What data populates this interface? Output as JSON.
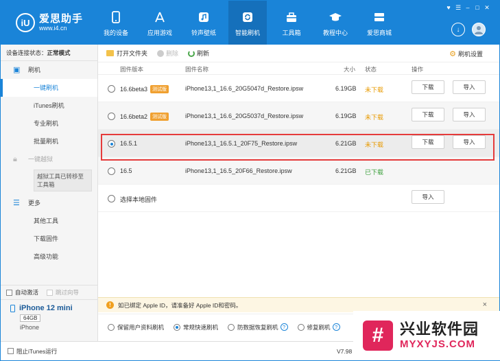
{
  "header": {
    "logo_mark": "iU",
    "logo_name": "爱思助手",
    "logo_url": "www.i4.cn",
    "nav": [
      {
        "label": "我的设备",
        "icon": "phone-icon"
      },
      {
        "label": "应用游戏",
        "icon": "app-store-icon"
      },
      {
        "label": "铃声壁纸",
        "icon": "music-icon"
      },
      {
        "label": "智能刷机",
        "icon": "flash-icon"
      },
      {
        "label": "工具箱",
        "icon": "toolbox-icon"
      },
      {
        "label": "教程中心",
        "icon": "graduation-cap-icon"
      },
      {
        "label": "爱思商城",
        "icon": "store-icon"
      }
    ],
    "active_nav": 3
  },
  "sidebar": {
    "status_label": "设备连接状态：",
    "status_value": "正常模式",
    "group_flash": "刷机",
    "items_flash": [
      "一键刷机",
      "iTunes刷机",
      "专业刷机",
      "批量刷机"
    ],
    "group_jailbreak": "一键越狱",
    "jailbreak_note": "越狱工具已转移至工具箱",
    "group_more": "更多",
    "items_more": [
      "其他工具",
      "下载固件",
      "高级功能"
    ],
    "check_auto_activate": "自动激活",
    "check_skip_guide": "跳过向导",
    "device_name": "iPhone 12 mini",
    "device_capacity": "64GB",
    "device_model": "iPhone"
  },
  "toolbar": {
    "open_folder": "打开文件夹",
    "delete": "删除",
    "refresh": "刷新",
    "flash_settings": "刷机设置"
  },
  "table": {
    "headers": {
      "version": "固件版本",
      "name": "固件名称",
      "size": "大小",
      "status": "状态",
      "action": "操作"
    },
    "rows": [
      {
        "version": "16.6beta3",
        "badge": "测试版",
        "name": "iPhone13,1_16.6_20G5047d_Restore.ipsw",
        "size": "6.19GB",
        "status": "未下载",
        "btn_download": "下载",
        "btn_import": "导入"
      },
      {
        "version": "16.6beta2",
        "badge": "测试版",
        "name": "iPhone13,1_16.6_20G5037d_Restore.ipsw",
        "size": "6.19GB",
        "status": "未下载",
        "btn_download": "下载",
        "btn_import": "导入"
      },
      {
        "version": "16.5.1",
        "badge": "",
        "name": "iPhone13,1_16.5.1_20F75_Restore.ipsw",
        "size": "6.21GB",
        "status": "未下载",
        "btn_download": "下载",
        "btn_import": "导入"
      },
      {
        "version": "16.5",
        "badge": "",
        "name": "iPhone13,1_16.5_20F66_Restore.ipsw",
        "size": "6.21GB",
        "status": "已下载"
      }
    ],
    "local_firmware": "选择本地固件",
    "local_import": "导入"
  },
  "notice": {
    "text": "如已绑定 Apple ID，请准备好 Apple ID和密码。",
    "close": "×"
  },
  "modes": [
    "保留用户资料刷机",
    "常规快速刷机",
    "防数据恢复刷机",
    "修复刷机"
  ],
  "mode_help": "?",
  "footer": {
    "block_itunes": "阻止iTunes运行",
    "version": "V7.98"
  },
  "watermark": {
    "cn": "兴业软件园",
    "en": "MYXYJS.COM"
  },
  "colors": {
    "brand": "#1a84d8",
    "status_not_downloaded": "#e89a00",
    "status_downloaded": "#3ca03c",
    "highlight": "#e53a3a"
  }
}
